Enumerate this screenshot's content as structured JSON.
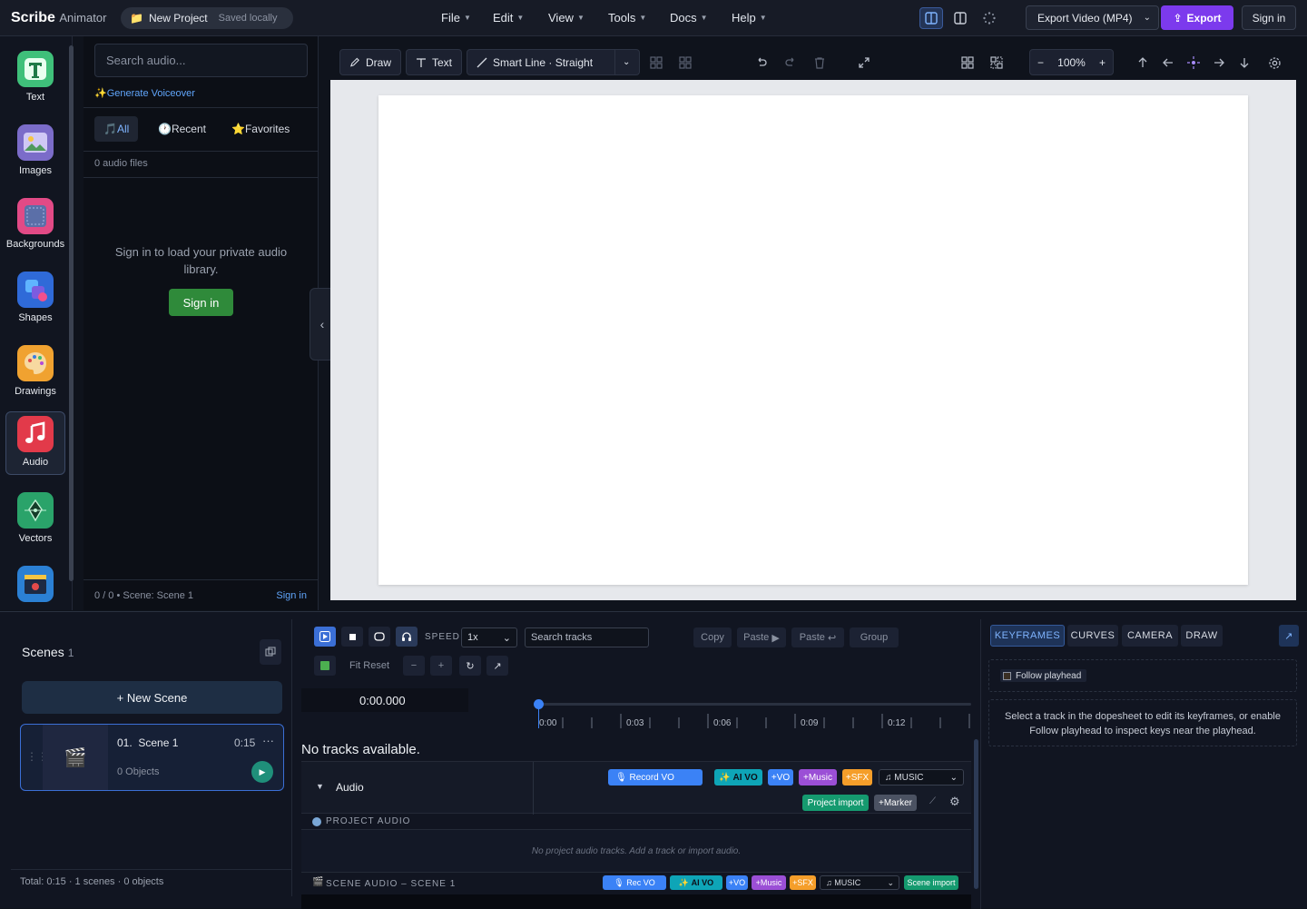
{
  "app": {
    "name": "Scribe",
    "name_suffix": "Animator"
  },
  "project": {
    "name": "New Project",
    "status": "Saved locally"
  },
  "menus": [
    "File",
    "Edit",
    "View",
    "Tools",
    "Docs",
    "Help"
  ],
  "export": {
    "video_label": "Export Video (MP4)",
    "button": "Export",
    "signin": "Sign in"
  },
  "rail": [
    {
      "label": "Text",
      "icon": "text-icon"
    },
    {
      "label": "Images",
      "icon": "image-icon"
    },
    {
      "label": "Backgrounds",
      "icon": "background-icon"
    },
    {
      "label": "Shapes",
      "icon": "shapes-icon"
    },
    {
      "label": "Drawings",
      "icon": "palette-icon"
    },
    {
      "label": "Audio",
      "icon": "music-icon"
    },
    {
      "label": "Vectors",
      "icon": "pen-nib-icon"
    },
    {
      "label": "",
      "icon": "clapperboard-icon"
    }
  ],
  "audio_panel": {
    "search_placeholder": "Search audio...",
    "generate_voiceover": "Generate Voiceover",
    "tabs": [
      "All",
      "Recent",
      "Favorites"
    ],
    "count": "0 audio files",
    "message": "Sign in to load your private audio library.",
    "signin": "Sign in",
    "footer": "0 / 0 • Scene: Scene 1",
    "footer_signin": "Sign in"
  },
  "canvas_toolbar": {
    "draw": "Draw",
    "text": "Text",
    "smart_line": "Smart Line · Straight",
    "zoom": "100%"
  },
  "scenes": {
    "title": "Scenes",
    "count": "1",
    "new_scene": "+ New Scene",
    "items": [
      {
        "index": "01.",
        "name": "Scene 1",
        "duration": "0:15",
        "objects": "0 Objects"
      }
    ],
    "total": "Total: 0:15 · 1 scenes · 0 objects"
  },
  "timeline": {
    "speed_label": "SPEED",
    "speed_value": "1x",
    "search_placeholder": "Search tracks",
    "copy": "Copy",
    "paste": "Paste",
    "paste2": "Paste",
    "group": "Group",
    "fit_reset": "Fit Reset",
    "time": "0:00.000",
    "ticks": [
      "0:00",
      "0:03",
      "0:06",
      "0:09",
      "0:12",
      "0"
    ],
    "no_tracks": "No tracks available.",
    "audio_label": "Audio",
    "record_vo": "Record VO",
    "ai_vo": "AI VO",
    "plus_vo": "+VO",
    "plus_music": "+Music",
    "plus_sfx": "+SFX",
    "music_select": "MUSIC",
    "project_import": "Project import",
    "plus_marker": "+Marker",
    "project_audio": "PROJECT AUDIO",
    "project_audio_empty": "No project audio tracks. Add a track or import audio.",
    "scene_audio": "SCENE AUDIO – SCENE 1",
    "rec_vo": "Rec VO",
    "scene_import": "Scene import"
  },
  "keyframes": {
    "tabs": [
      "KEYFRAMES",
      "CURVES",
      "CAMERA",
      "DRAW"
    ],
    "follow": "Follow playhead",
    "hint": "Select a track in the dopesheet to edit its keyframes, or enable Follow playhead to inspect keys near the playhead."
  },
  "colors": {
    "accent": "#7c3aed",
    "blue": "#3b6fd6",
    "green": "#2f8a3a"
  }
}
